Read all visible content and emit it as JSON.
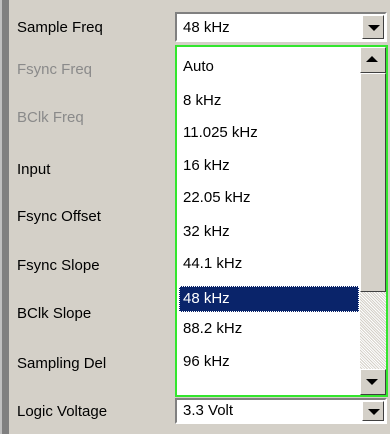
{
  "labels": {
    "sample_freq": "Sample Freq",
    "fsync_freq": "Fsync Freq",
    "bclk_freq": "BClk Freq",
    "input": "Input",
    "fsync_offset": "Fsync Offset",
    "fsync_slope": "Fsync Slope",
    "bclk_slope": "BClk Slope",
    "sampling_del": "Sampling Del",
    "logic_voltage": "Logic Voltage"
  },
  "sample_freq_value": "48 kHz",
  "logic_voltage_value": "3.3 Volt",
  "dropdown": {
    "options": [
      "Auto",
      "8 kHz",
      "11.025 kHz",
      "16 kHz",
      "22.05 kHz",
      "32 kHz",
      "44.1 kHz",
      "48 kHz",
      "88.2 kHz",
      "96 kHz"
    ],
    "selected": "48 kHz"
  },
  "colors": {
    "focus_border": "#33e62e",
    "selection": "#0a246a",
    "disabled_text": "#8a8a8a"
  }
}
